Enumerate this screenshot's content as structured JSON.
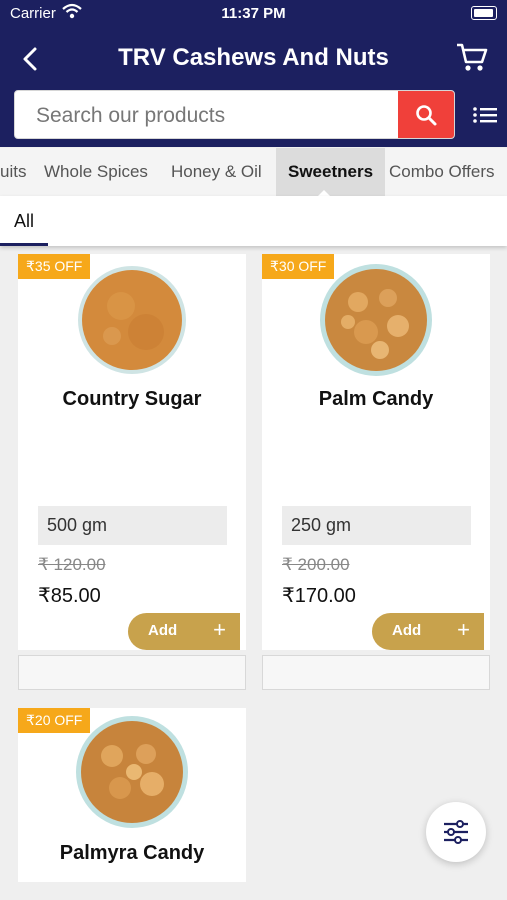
{
  "status_bar": {
    "carrier": "Carrier",
    "time": "11:37 PM"
  },
  "header": {
    "title": "TRV Cashews And Nuts"
  },
  "search": {
    "placeholder": "Search our products"
  },
  "categories": [
    {
      "label": "uits"
    },
    {
      "label": "Whole Spices"
    },
    {
      "label": "Honey & Oil"
    },
    {
      "label": "Sweetners",
      "active": true
    },
    {
      "label": "Combo Offers"
    }
  ],
  "subtabs": [
    {
      "label": "All",
      "active": true
    }
  ],
  "products": [
    {
      "discount": "₹35 OFF",
      "name": "Country Sugar",
      "weight": "500 gm",
      "mrp": "₹ 120.00",
      "price": "₹85.00",
      "add_label": "Add"
    },
    {
      "discount": "₹30 OFF",
      "name": "Palm Candy",
      "weight": "250 gm",
      "mrp": "₹ 200.00",
      "price": "₹170.00",
      "add_label": "Add"
    },
    {
      "discount": "₹20 OFF",
      "name": "Palmyra Candy"
    }
  ],
  "colors": {
    "header": "#1c2060",
    "search_button": "#f0403a",
    "badge": "#f6a81a",
    "add_button": "#c8a24c"
  }
}
